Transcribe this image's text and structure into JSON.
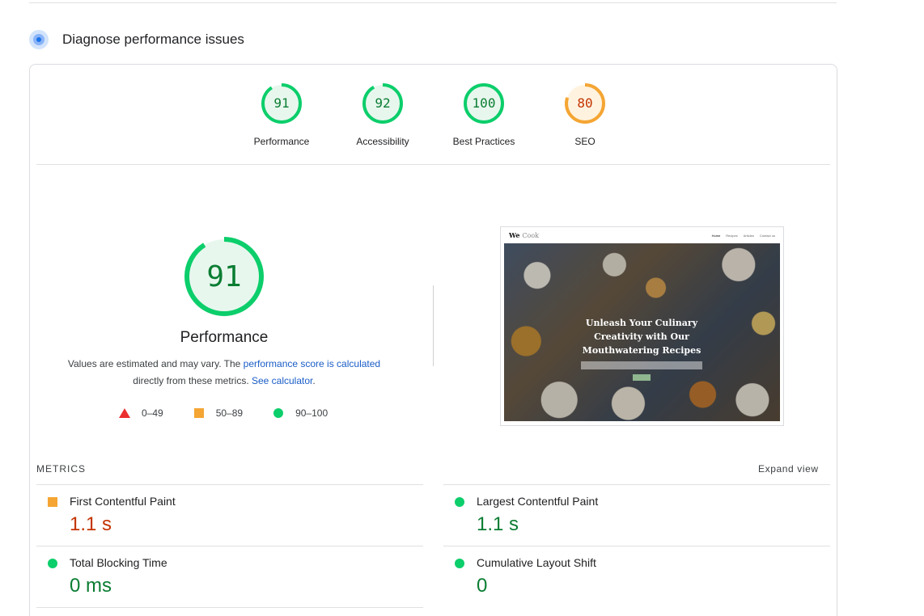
{
  "header": {
    "title": "Diagnose performance issues",
    "icon": "diagnose-icon"
  },
  "gauges": [
    {
      "score": "91",
      "label": "Performance",
      "status": "pass",
      "fraction": 0.91,
      "color": "#0cce6b"
    },
    {
      "score": "92",
      "label": "Accessibility",
      "status": "pass",
      "fraction": 0.92,
      "color": "#0cce6b"
    },
    {
      "score": "100",
      "label": "Best Practices",
      "status": "pass",
      "fraction": 1.0,
      "color": "#0cce6b"
    },
    {
      "score": "80",
      "label": "SEO",
      "status": "average",
      "fraction": 0.8,
      "color": "#f4a533"
    }
  ],
  "performance": {
    "score": "91",
    "fraction": 0.91,
    "title": "Performance",
    "desc_part1": "Values are estimated and may vary. The ",
    "desc_link1": "performance score is calculated",
    "desc_part2": " directly from these metrics. ",
    "desc_link2": "See calculator",
    "desc_part3": "."
  },
  "legend": [
    {
      "shape": "triangle",
      "range": "0–49",
      "color": "#eb2f2f"
    },
    {
      "shape": "square",
      "range": "50–89",
      "color": "#f4a533"
    },
    {
      "shape": "circle",
      "range": "90–100",
      "color": "#0cce6b"
    }
  ],
  "screenshot": {
    "logo_we": "We",
    "logo_cook": "Cook",
    "nav": [
      "Home",
      "Recipes",
      "Articles",
      "Contact us"
    ],
    "hero_text": "Unleash Your Culinary Creativity with Our Mouthwatering Recipes"
  },
  "metrics": {
    "section_label": "METRICS",
    "expand_label": "Expand view",
    "items": [
      {
        "title": "First Contentful Paint",
        "value": "1.1 s",
        "status": "average"
      },
      {
        "title": "Largest Contentful Paint",
        "value": "1.1 s",
        "status": "pass"
      },
      {
        "title": "Total Blocking Time",
        "value": "0 ms",
        "status": "pass"
      },
      {
        "title": "Cumulative Layout Shift",
        "value": "0",
        "status": "pass"
      }
    ]
  },
  "colors": {
    "pass": "#0a7d32",
    "average": "#c33300",
    "link": "#1a5dc7"
  }
}
